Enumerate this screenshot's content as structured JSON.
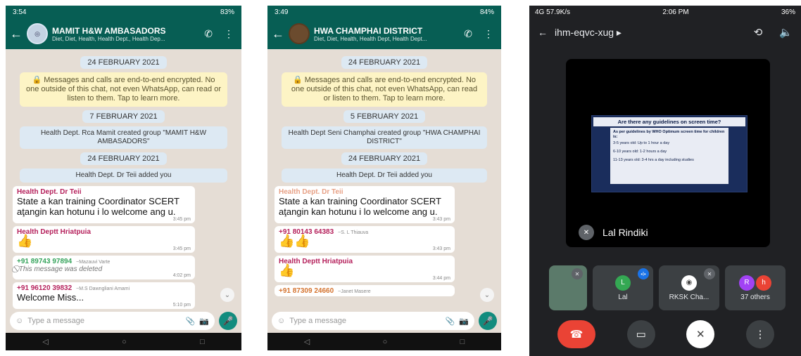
{
  "phone1": {
    "status": {
      "time": "3:54",
      "battery": "83%"
    },
    "header": {
      "title": "MAMIT H&W AMBASADORS",
      "subtitle": "Diet, Diet, Health, Health Dept., Health Dep..."
    },
    "messages": [
      {
        "kind": "date",
        "text": "24 FEBRUARY 2021"
      },
      {
        "kind": "enc",
        "text": "🔒 Messages and calls are end-to-end encrypted. No one outside of this chat, not even WhatsApp, can read or listen to them. Tap to learn more."
      },
      {
        "kind": "date",
        "text": "7 FEBRUARY 2021"
      },
      {
        "kind": "sys",
        "text": "Health Dept. Rca Mamit created group \"MAMIT H&W AMBASADORS\""
      },
      {
        "kind": "date",
        "text": "24 FEBRUARY 2021"
      },
      {
        "kind": "sys",
        "text": "Health Dept. Dr Teii added you"
      },
      {
        "kind": "msg",
        "sender": "Health Dept. Dr Teii",
        "sender_color": "#b5205b",
        "text": "State a kan training Coordinator SCERT aţangin kan hotunu i lo welcome ang u.",
        "time": "3:45 pm"
      },
      {
        "kind": "msg",
        "sender": "Health Deptt Hriatpuia",
        "sender_color": "#b5205b",
        "text": "👍",
        "time": "3:45 pm"
      },
      {
        "kind": "msg",
        "sender": "+91 89743 97894",
        "meta": "~Mazauvi Varte",
        "sender_color": "#35a35b",
        "deleted": "⃠ This message was deleted",
        "time": "4:02 pm"
      },
      {
        "kind": "msg",
        "sender": "+91 96120 39832",
        "meta": "~M.S Dawngliani Amami",
        "sender_color": "#b5205b",
        "text": "Welcome Miss...",
        "time": "5:10 pm"
      }
    ],
    "input_placeholder": "Type a message"
  },
  "phone2": {
    "status": {
      "time": "3:49",
      "battery": "84%"
    },
    "header": {
      "title": "HWA CHAMPHAI DISTRICT",
      "subtitle": "Diet, Diet, Health, Health Dept, Health Dept..."
    },
    "messages": [
      {
        "kind": "date",
        "text": "24 FEBRUARY 2021"
      },
      {
        "kind": "enc",
        "text": "🔒 Messages and calls are end-to-end encrypted. No one outside of this chat, not even WhatsApp, can read or listen to them. Tap to learn more."
      },
      {
        "kind": "date",
        "text": "5 FEBRUARY 2021"
      },
      {
        "kind": "sys",
        "text": "Health Dept Seni Champhai created group \"HWA CHAMPHAI DISTRICT\""
      },
      {
        "kind": "date",
        "text": "24 FEBRUARY 2021"
      },
      {
        "kind": "sys",
        "text": "Health Dept. Dr Teii added you"
      },
      {
        "kind": "msg",
        "sender": "Health Dept. Dr Teii",
        "sender_color": "#e7a085",
        "text": "State a kan training Coordinator SCERT aţangin kan hotunu i lo welcome ang u.",
        "time": "3:43 pm"
      },
      {
        "kind": "msg",
        "sender": "+91 80143 64383",
        "meta": "~S. L Thiauva",
        "sender_color": "#b5205b",
        "text": "👍👍",
        "time": "3:43 pm"
      },
      {
        "kind": "msg",
        "sender": "Health Deptt Hriatpuia",
        "sender_color": "#b5205b",
        "text": "👍",
        "time": "3:44 pm"
      },
      {
        "kind": "msg",
        "sender": "+91 87309 24660",
        "meta": "~Janet Masere",
        "sender_color": "#d4732f",
        "text": "",
        "time": ""
      }
    ],
    "input_placeholder": "Type a message"
  },
  "meet": {
    "status": {
      "left": "4G 57.9K/s",
      "time": "2:06 PM",
      "battery": "36%"
    },
    "meeting_code": "ihm-eqvc-xug",
    "slide": {
      "title": "Are there any guidelines on screen time?",
      "intro": "As per guidelines by WHO Optimum screen time for children is:",
      "lines": [
        "3-5  years  old: Up to 1 hour a day",
        "6-10 years  old: 1-2 hours a day",
        "11-13 years old: 3-4 hrs a day including studies"
      ]
    },
    "presenter_name": "Lal Rindiki",
    "participants": [
      {
        "label": "Lal",
        "initial": "L",
        "color": "#34a853"
      },
      {
        "label": "RKSK Cha...",
        "initial": "",
        "color": "#ffffff"
      },
      {
        "label": "37 others",
        "initial": "R",
        "initial2": "h",
        "color": "#a142f4",
        "color2": "#ea4335"
      }
    ]
  }
}
